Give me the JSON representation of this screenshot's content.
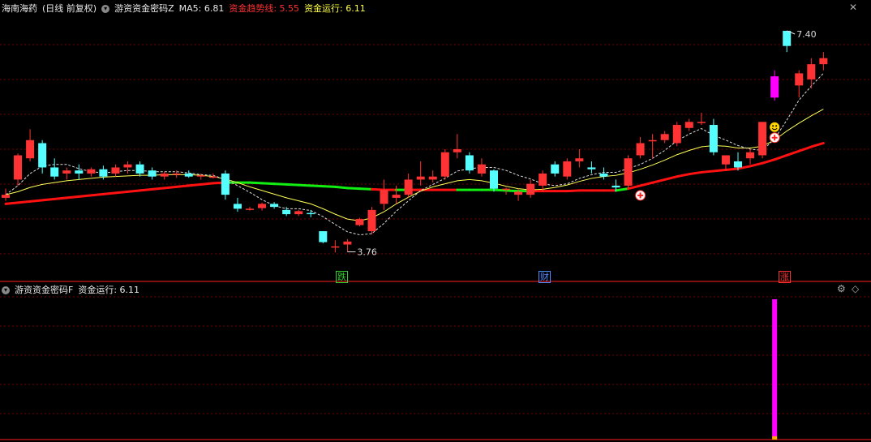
{
  "header": {
    "stock_name": "海南海药",
    "period": "(日线 前复权)",
    "indicator_main": "游资资金密码Z",
    "ma5_text": "MA5: 6.81",
    "trend_text": "资金趋势线: 5.55",
    "run_text": "资金运行: 6.11"
  },
  "sub_header": {
    "indicator_sub": "游资资金密码F",
    "run_text": "资金运行: 6.11"
  },
  "markers": {
    "low_label": "3.76",
    "high_label": "7.40"
  },
  "signals": [
    {
      "text": "跌",
      "color": "#30d030"
    },
    {
      "text": "财",
      "color": "#4c8cff"
    },
    {
      "text": "涨",
      "color": "#ff3030"
    }
  ],
  "controls": {
    "close": "✕",
    "settings": "⚙",
    "collapse": "◇"
  },
  "colors": {
    "up": "#ff3333",
    "down": "#55ffff",
    "ma5": "#dddddd",
    "run": "#ffff55",
    "trend_up": "#ff1111",
    "trend_down": "#11ee11",
    "spike": "#ff00ff",
    "grid": "#7a0000",
    "divider": "#ff2020"
  },
  "chart_data": {
    "type": "candlestick",
    "series_names": [
      "MA5",
      "资金趋势线",
      "资金运行"
    ],
    "ylim": [
      3.5,
      7.6
    ],
    "candles": [
      [
        4.65,
        4.8,
        4.6,
        4.7
      ],
      [
        4.95,
        5.38,
        4.85,
        5.35
      ],
      [
        5.3,
        5.78,
        5.25,
        5.6
      ],
      [
        5.55,
        5.6,
        5.05,
        5.15
      ],
      [
        5.15,
        5.3,
        4.95,
        5.0
      ],
      [
        5.05,
        5.15,
        4.95,
        5.1
      ],
      [
        5.1,
        5.2,
        4.95,
        5.05
      ],
      [
        5.05,
        5.15,
        5.0,
        5.12
      ],
      [
        5.12,
        5.18,
        4.95,
        5.0
      ],
      [
        5.05,
        5.2,
        5.0,
        5.15
      ],
      [
        5.15,
        5.25,
        5.05,
        5.2
      ],
      [
        5.2,
        5.25,
        5.0,
        5.05
      ],
      [
        5.1,
        5.15,
        4.95,
        5.0
      ],
      [
        5.0,
        5.08,
        4.95,
        5.05
      ],
      [
        5.05,
        5.1,
        4.98,
        5.05
      ],
      [
        5.05,
        5.1,
        4.98,
        5.0
      ],
      [
        5.0,
        5.05,
        4.95,
        5.02
      ],
      [
        5.0,
        5.05,
        4.97,
        5.0
      ],
      [
        5.05,
        5.1,
        4.62,
        4.7
      ],
      [
        4.55,
        4.65,
        4.42,
        4.47
      ],
      [
        4.47,
        4.5,
        4.44,
        4.47
      ],
      [
        4.48,
        4.57,
        4.44,
        4.55
      ],
      [
        4.55,
        4.58,
        4.47,
        4.5
      ],
      [
        4.45,
        4.5,
        4.35,
        4.38
      ],
      [
        4.38,
        4.45,
        4.35,
        4.43
      ],
      [
        4.4,
        4.45,
        4.33,
        4.38
      ],
      [
        4.1,
        4.1,
        3.9,
        3.92
      ],
      [
        3.85,
        3.95,
        3.75,
        3.85
      ],
      [
        3.88,
        3.97,
        3.76,
        3.93
      ],
      [
        4.2,
        4.32,
        4.18,
        4.3
      ],
      [
        4.1,
        4.5,
        4.05,
        4.45
      ],
      [
        4.55,
        4.95,
        4.45,
        4.78
      ],
      [
        4.65,
        4.85,
        4.55,
        4.7
      ],
      [
        4.7,
        5.05,
        4.65,
        4.95
      ],
      [
        4.95,
        5.25,
        4.85,
        5.0
      ],
      [
        4.95,
        5.1,
        4.9,
        5.0
      ],
      [
        5.0,
        5.45,
        4.95,
        5.4
      ],
      [
        5.4,
        5.7,
        5.3,
        5.45
      ],
      [
        5.35,
        5.4,
        5.05,
        5.1
      ],
      [
        5.05,
        5.3,
        5.0,
        5.2
      ],
      [
        5.1,
        5.12,
        4.75,
        4.8
      ],
      [
        4.78,
        4.82,
        4.7,
        4.8
      ],
      [
        4.7,
        4.8,
        4.6,
        4.75
      ],
      [
        4.7,
        4.95,
        4.65,
        4.88
      ],
      [
        4.85,
        5.1,
        4.75,
        5.05
      ],
      [
        5.2,
        5.25,
        5.0,
        5.05
      ],
      [
        5.0,
        5.3,
        4.95,
        5.25
      ],
      [
        5.25,
        5.45,
        5.15,
        5.3
      ],
      [
        5.15,
        5.25,
        5.05,
        5.12
      ],
      [
        5.05,
        5.15,
        4.95,
        5.0
      ],
      [
        4.85,
        4.95,
        4.75,
        4.82
      ],
      [
        4.85,
        5.35,
        4.8,
        5.3
      ],
      [
        5.35,
        5.65,
        5.3,
        5.55
      ],
      [
        5.6,
        5.7,
        5.3,
        5.6
      ],
      [
        5.6,
        5.75,
        5.55,
        5.7
      ],
      [
        5.55,
        5.9,
        5.5,
        5.85
      ],
      [
        5.8,
        5.95,
        5.75,
        5.9
      ],
      [
        5.9,
        6.05,
        5.85,
        5.9
      ],
      [
        5.85,
        5.95,
        5.35,
        5.4
      ],
      [
        5.2,
        5.35,
        5.1,
        5.35
      ],
      [
        5.25,
        5.4,
        5.1,
        5.15
      ],
      [
        5.3,
        5.45,
        5.2,
        5.4
      ],
      [
        5.35,
        5.9,
        5.3,
        5.9
      ],
      [
        6.3,
        6.75,
        6.25,
        6.65
      ],
      [
        7.4,
        7.4,
        7.05,
        7.15
      ],
      [
        6.5,
        6.75,
        6.3,
        6.7
      ],
      [
        6.6,
        6.95,
        6.45,
        6.85
      ],
      [
        6.85,
        7.05,
        6.75,
        6.95
      ]
    ],
    "ma5": [
      4.7,
      4.85,
      5.05,
      5.17,
      5.2,
      5.2,
      5.13,
      5.08,
      5.06,
      5.08,
      5.1,
      5.1,
      5.08,
      5.08,
      5.08,
      5.06,
      5.03,
      5.02,
      4.95,
      4.85,
      4.74,
      4.62,
      4.52,
      4.47,
      4.47,
      4.44,
      4.34,
      4.21,
      4.09,
      4.04,
      4.06,
      4.23,
      4.43,
      4.6,
      4.77,
      4.87,
      4.97,
      5.09,
      5.13,
      5.15,
      5.15,
      5.1,
      5.02,
      4.96,
      4.88,
      4.85,
      4.88,
      4.97,
      5.03,
      5.07,
      5.07,
      5.13,
      5.2,
      5.3,
      5.43,
      5.59,
      5.7,
      5.79,
      5.68,
      5.6,
      5.51,
      5.45,
      5.43,
      5.62,
      5.93,
      6.26,
      6.49,
      6.7
    ],
    "run": [
      4.7,
      4.75,
      4.82,
      4.87,
      4.9,
      4.93,
      4.95,
      4.97,
      4.99,
      5.0,
      5.01,
      5.02,
      5.02,
      5.03,
      5.03,
      5.03,
      5.02,
      5.0,
      4.96,
      4.9,
      4.83,
      4.77,
      4.71,
      4.65,
      4.6,
      4.55,
      4.47,
      4.38,
      4.3,
      4.27,
      4.32,
      4.42,
      4.55,
      4.66,
      4.76,
      4.83,
      4.88,
      4.93,
      4.95,
      4.93,
      4.89,
      4.84,
      4.8,
      4.78,
      4.79,
      4.82,
      4.86,
      4.92,
      4.97,
      5.0,
      5.02,
      5.06,
      5.12,
      5.19,
      5.27,
      5.36,
      5.43,
      5.49,
      5.51,
      5.5,
      5.47,
      5.47,
      5.5,
      5.6,
      5.75,
      5.88,
      6.0,
      6.11
    ],
    "trend": [
      4.55,
      4.57,
      4.59,
      4.61,
      4.63,
      4.65,
      4.67,
      4.69,
      4.71,
      4.73,
      4.75,
      4.77,
      4.79,
      4.81,
      4.83,
      4.85,
      4.87,
      4.89,
      4.9,
      4.9,
      4.9,
      4.89,
      4.88,
      4.87,
      4.86,
      4.85,
      4.84,
      4.83,
      4.81,
      4.8,
      4.79,
      4.78,
      4.78,
      4.78,
      4.78,
      4.78,
      4.78,
      4.78,
      4.78,
      4.78,
      4.78,
      4.77,
      4.76,
      4.76,
      4.76,
      4.76,
      4.76,
      4.77,
      4.77,
      4.77,
      4.77,
      4.8,
      4.85,
      4.9,
      4.95,
      5.0,
      5.04,
      5.07,
      5.09,
      5.11,
      5.13,
      5.17,
      5.22,
      5.28,
      5.35,
      5.42,
      5.49,
      5.55
    ],
    "trend_color": [
      "u",
      "u",
      "u",
      "u",
      "u",
      "u",
      "u",
      "u",
      "u",
      "u",
      "u",
      "u",
      "u",
      "u",
      "u",
      "u",
      "u",
      "u",
      "d",
      "d",
      "d",
      "d",
      "d",
      "d",
      "d",
      "d",
      "d",
      "d",
      "d",
      "d",
      "u",
      "u",
      "d",
      "u",
      "u",
      "u",
      "u",
      "d",
      "d",
      "d",
      "d",
      "d",
      "d",
      "u",
      "u",
      "u",
      "u",
      "u",
      "u",
      "u",
      "d",
      "u",
      "u",
      "u",
      "u",
      "u",
      "u",
      "u",
      "u",
      "u",
      "u",
      "u",
      "u",
      "u",
      "u",
      "u",
      "u",
      "u"
    ],
    "spike_index": 63,
    "sub_spike_index": 63
  }
}
